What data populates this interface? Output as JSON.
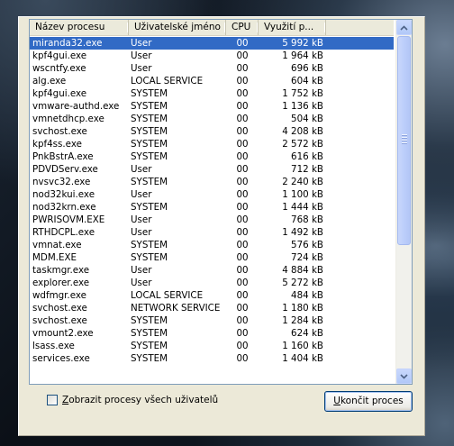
{
  "columns": {
    "name": "Název procesu",
    "user": "Uživatelské jméno",
    "cpu": "CPU",
    "mem": "Využití p..."
  },
  "processes": [
    {
      "name": "miranda32.exe",
      "user": "User",
      "cpu": "00",
      "mem": "5 992 kB"
    },
    {
      "name": "kpf4gui.exe",
      "user": "User",
      "cpu": "00",
      "mem": "1 964 kB"
    },
    {
      "name": "wscntfy.exe",
      "user": "User",
      "cpu": "00",
      "mem": "696 kB"
    },
    {
      "name": "alg.exe",
      "user": "LOCAL SERVICE",
      "cpu": "00",
      "mem": "604 kB"
    },
    {
      "name": "kpf4gui.exe",
      "user": "SYSTEM",
      "cpu": "00",
      "mem": "1 752 kB"
    },
    {
      "name": "vmware-authd.exe",
      "user": "SYSTEM",
      "cpu": "00",
      "mem": "1 136 kB"
    },
    {
      "name": "vmnetdhcp.exe",
      "user": "SYSTEM",
      "cpu": "00",
      "mem": "504 kB"
    },
    {
      "name": "svchost.exe",
      "user": "SYSTEM",
      "cpu": "00",
      "mem": "4 208 kB"
    },
    {
      "name": "kpf4ss.exe",
      "user": "SYSTEM",
      "cpu": "00",
      "mem": "2 572 kB"
    },
    {
      "name": "PnkBstrA.exe",
      "user": "SYSTEM",
      "cpu": "00",
      "mem": "616 kB"
    },
    {
      "name": "PDVDServ.exe",
      "user": "User",
      "cpu": "00",
      "mem": "712 kB"
    },
    {
      "name": "nvsvc32.exe",
      "user": "SYSTEM",
      "cpu": "00",
      "mem": "2 240 kB"
    },
    {
      "name": "nod32kui.exe",
      "user": "User",
      "cpu": "00",
      "mem": "1 100 kB"
    },
    {
      "name": "nod32krn.exe",
      "user": "SYSTEM",
      "cpu": "00",
      "mem": "1 444 kB"
    },
    {
      "name": "PWRISOVM.EXE",
      "user": "User",
      "cpu": "00",
      "mem": "768 kB"
    },
    {
      "name": "RTHDCPL.exe",
      "user": "User",
      "cpu": "00",
      "mem": "1 492 kB"
    },
    {
      "name": "vmnat.exe",
      "user": "SYSTEM",
      "cpu": "00",
      "mem": "576 kB"
    },
    {
      "name": "MDM.EXE",
      "user": "SYSTEM",
      "cpu": "00",
      "mem": "724 kB"
    },
    {
      "name": "taskmgr.exe",
      "user": "User",
      "cpu": "00",
      "mem": "4 884 kB"
    },
    {
      "name": "explorer.exe",
      "user": "User",
      "cpu": "00",
      "mem": "5 272 kB"
    },
    {
      "name": "wdfmgr.exe",
      "user": "LOCAL SERVICE",
      "cpu": "00",
      "mem": "484 kB"
    },
    {
      "name": "svchost.exe",
      "user": "NETWORK SERVICE",
      "cpu": "00",
      "mem": "1 180 kB"
    },
    {
      "name": "svchost.exe",
      "user": "SYSTEM",
      "cpu": "00",
      "mem": "1 284 kB"
    },
    {
      "name": "vmount2.exe",
      "user": "SYSTEM",
      "cpu": "00",
      "mem": "624 kB"
    },
    {
      "name": "lsass.exe",
      "user": "SYSTEM",
      "cpu": "00",
      "mem": "1 160 kB"
    },
    {
      "name": "services.exe",
      "user": "SYSTEM",
      "cpu": "00",
      "mem": "1 404 kB"
    }
  ],
  "selected_index": 0,
  "show_all_users": {
    "label": "Zobrazit procesy všech uživatelů",
    "checked": false
  },
  "end_process_button": "Ukončit proces",
  "colors": {
    "selection": "#316ac5",
    "panel": "#ece9d8",
    "border": "#7f9db9"
  },
  "icons": {
    "scroll_up": "chevron-up-icon",
    "scroll_down": "chevron-down-icon"
  }
}
